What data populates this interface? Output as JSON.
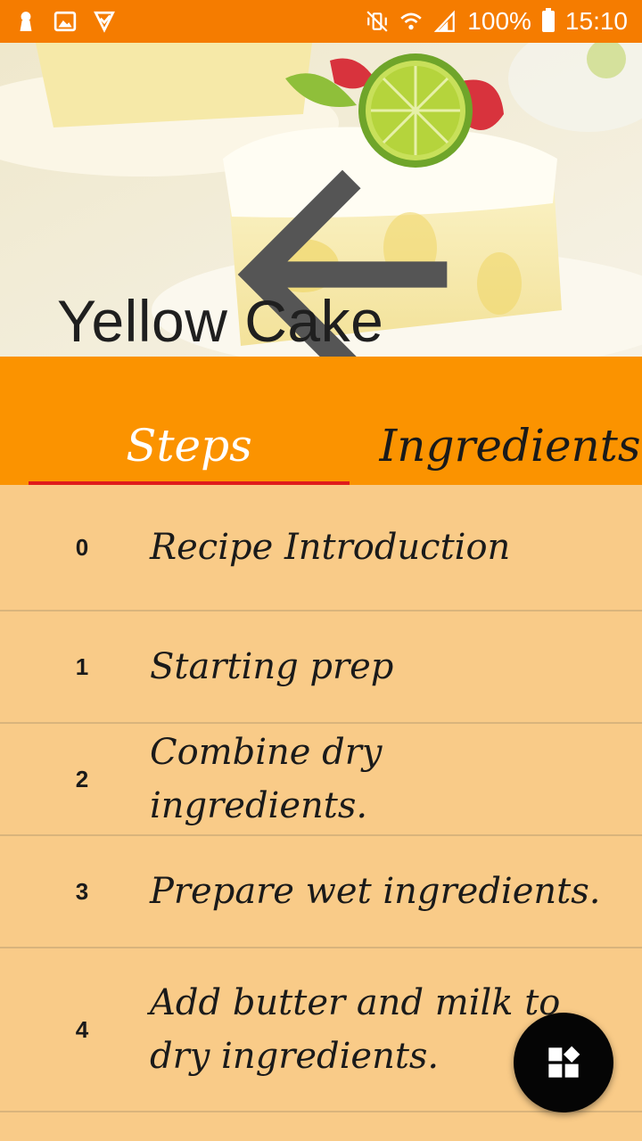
{
  "status_bar": {
    "battery": "100%",
    "time": "15:10"
  },
  "recipe": {
    "title": "Yellow Cake"
  },
  "tabs": [
    {
      "label": "Steps",
      "selected": true
    },
    {
      "label": "Ingredients",
      "selected": false
    }
  ],
  "steps": [
    {
      "number": "0",
      "text": "Recipe Introduction"
    },
    {
      "number": "1",
      "text": "Starting prep"
    },
    {
      "number": "2",
      "text": "Combine dry ingredients."
    },
    {
      "number": "3",
      "text": "Prepare wet ingredients."
    },
    {
      "number": "4",
      "text": "Add butter and milk to dry ingredients."
    }
  ],
  "colors": {
    "status_bar": "#f57c00",
    "tab_bar": "#fb9300",
    "list_background": "#f9cb88",
    "tab_indicator": "#e01b1b",
    "fab": "#050505"
  },
  "icons": {
    "back": "arrow-left-icon",
    "fab": "widgets-icon"
  }
}
